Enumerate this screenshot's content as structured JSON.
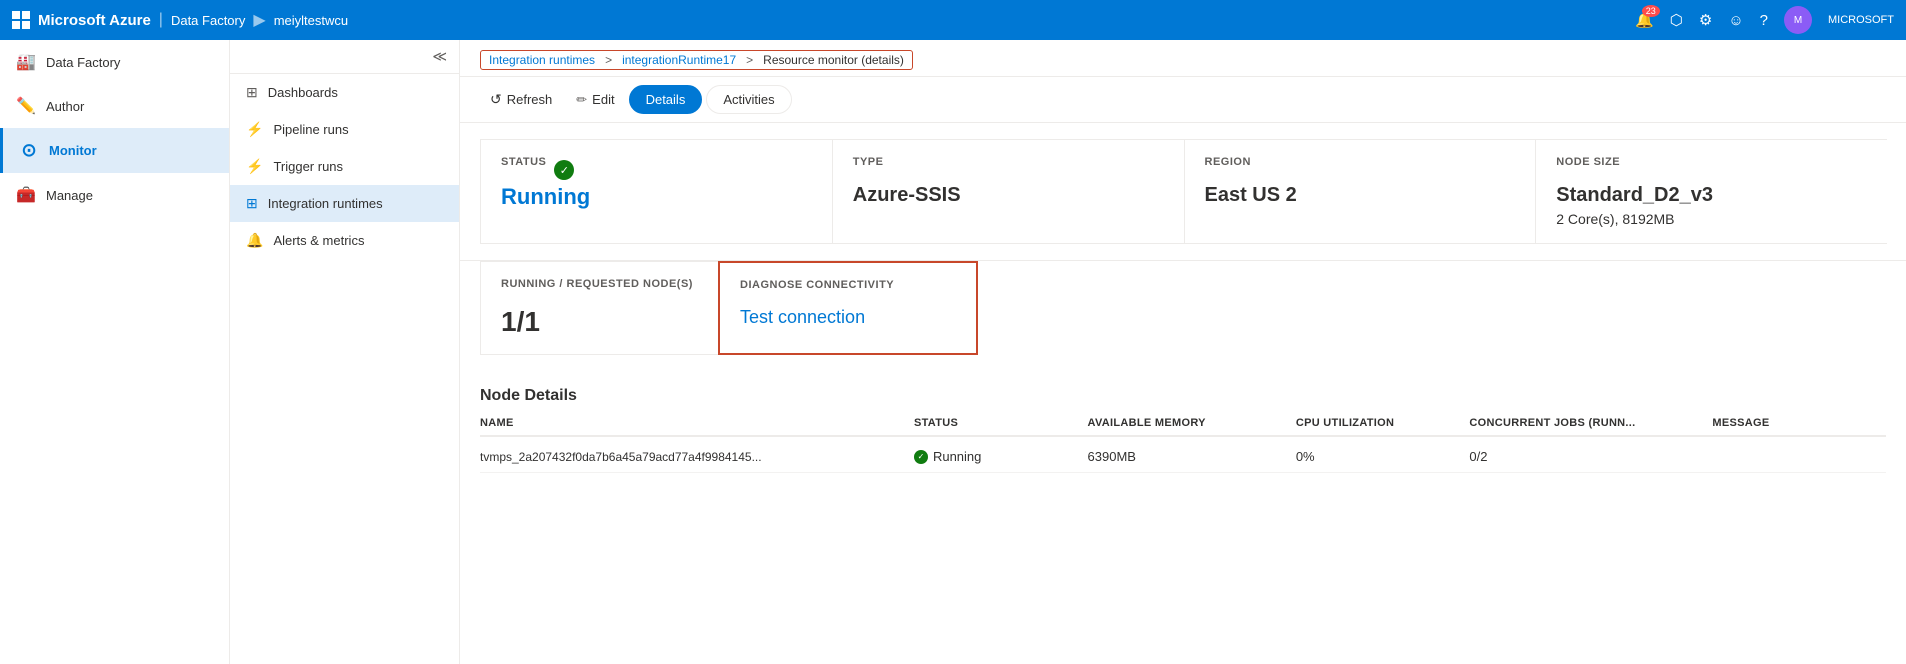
{
  "topbar": {
    "brand": "Microsoft Azure",
    "separator": "|",
    "service": "Data Factory",
    "arrow": "▶",
    "factory_name": "meiyltestwcu",
    "notifications_count": "23",
    "user_label": "MICROSOFT"
  },
  "breadcrumb": {
    "link1": "Integration runtimes",
    "sep1": ">",
    "link2": "integrationRuntime17",
    "sep2": ">",
    "current": "Resource monitor (details)"
  },
  "toolbar": {
    "refresh_label": "Refresh",
    "edit_label": "Edit",
    "details_tab": "Details",
    "activities_tab": "Activities"
  },
  "panels": {
    "status": {
      "label": "STATUS",
      "value": "Running"
    },
    "type": {
      "label": "TYPE",
      "value": "Azure-SSIS"
    },
    "region": {
      "label": "REGION",
      "value": "East US 2"
    },
    "node_size": {
      "label": "NODE SIZE",
      "line1": "Standard_D2_v3",
      "line2": "2 Core(s), 8192MB"
    }
  },
  "lower_panels": {
    "running_nodes": {
      "label": "RUNNING / REQUESTED NODE(S)",
      "value": "1/1"
    },
    "diagnose": {
      "label": "DIAGNOSE CONNECTIVITY",
      "value": "Test connection"
    }
  },
  "node_details": {
    "title": "Node Details",
    "columns": {
      "name": "NAME",
      "status": "STATUS",
      "memory": "AVAILABLE MEMORY",
      "cpu": "CPU UTILIZATION",
      "jobs": "CONCURRENT JOBS (RUNN...",
      "message": "MESSAGE"
    },
    "rows": [
      {
        "name": "tvmps_2a207432f0da7b6a45a79acd77a4f9984145...",
        "status": "Running",
        "memory": "6390MB",
        "cpu": "0%",
        "jobs": "0/2",
        "message": ""
      }
    ]
  },
  "left_sidebar": {
    "items": [
      {
        "label": "Data Factory",
        "icon": "🏭",
        "active": false
      },
      {
        "label": "Author",
        "icon": "✏️",
        "active": false
      },
      {
        "label": "Monitor",
        "icon": "🔵",
        "active": true
      },
      {
        "label": "Manage",
        "icon": "🧰",
        "active": false
      }
    ]
  },
  "second_sidebar": {
    "items": [
      {
        "label": "Dashboards",
        "icon": "⊞"
      },
      {
        "label": "Pipeline runs",
        "icon": "⚡"
      },
      {
        "label": "Trigger runs",
        "icon": "⚡"
      },
      {
        "label": "Integration runtimes",
        "icon": "⊞",
        "active": true
      },
      {
        "label": "Alerts & metrics",
        "icon": "🔔"
      }
    ]
  }
}
